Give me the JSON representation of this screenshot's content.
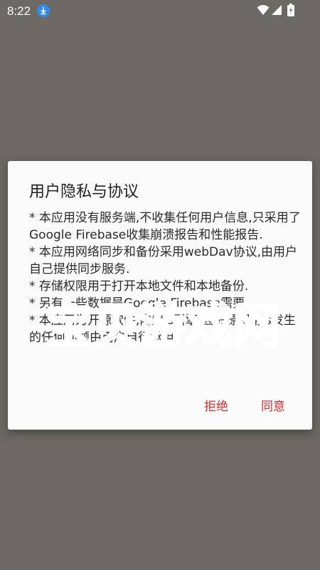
{
  "status_bar": {
    "time": "8:22",
    "icons": [
      "download-icon",
      "wifi-icon",
      "signal-icon",
      "battery-icon"
    ]
  },
  "dialog": {
    "title": "用户隐私与协议",
    "paragraphs": [
      "* 本应用没有服务端,不收集任何用户信息,只采用了Google Firebase收集崩溃报告和性能报告.",
      "* 本应用网络同步和备份采用webDav协议,由用户自己提供同步服务.",
      "* 存储权限用于打开本地文件和本地备份.",
      "* 另有一些数据是Google Firebase需要",
      "* 本应用为开源软件,内置js引擎,因书源调用js发生的任何问题由用户自行承担."
    ],
    "buttons": {
      "reject": "拒绝",
      "agree": "同意"
    },
    "accent_color": "#d32f2f"
  },
  "watermark": {
    "text": "宝贝游戏网"
  }
}
